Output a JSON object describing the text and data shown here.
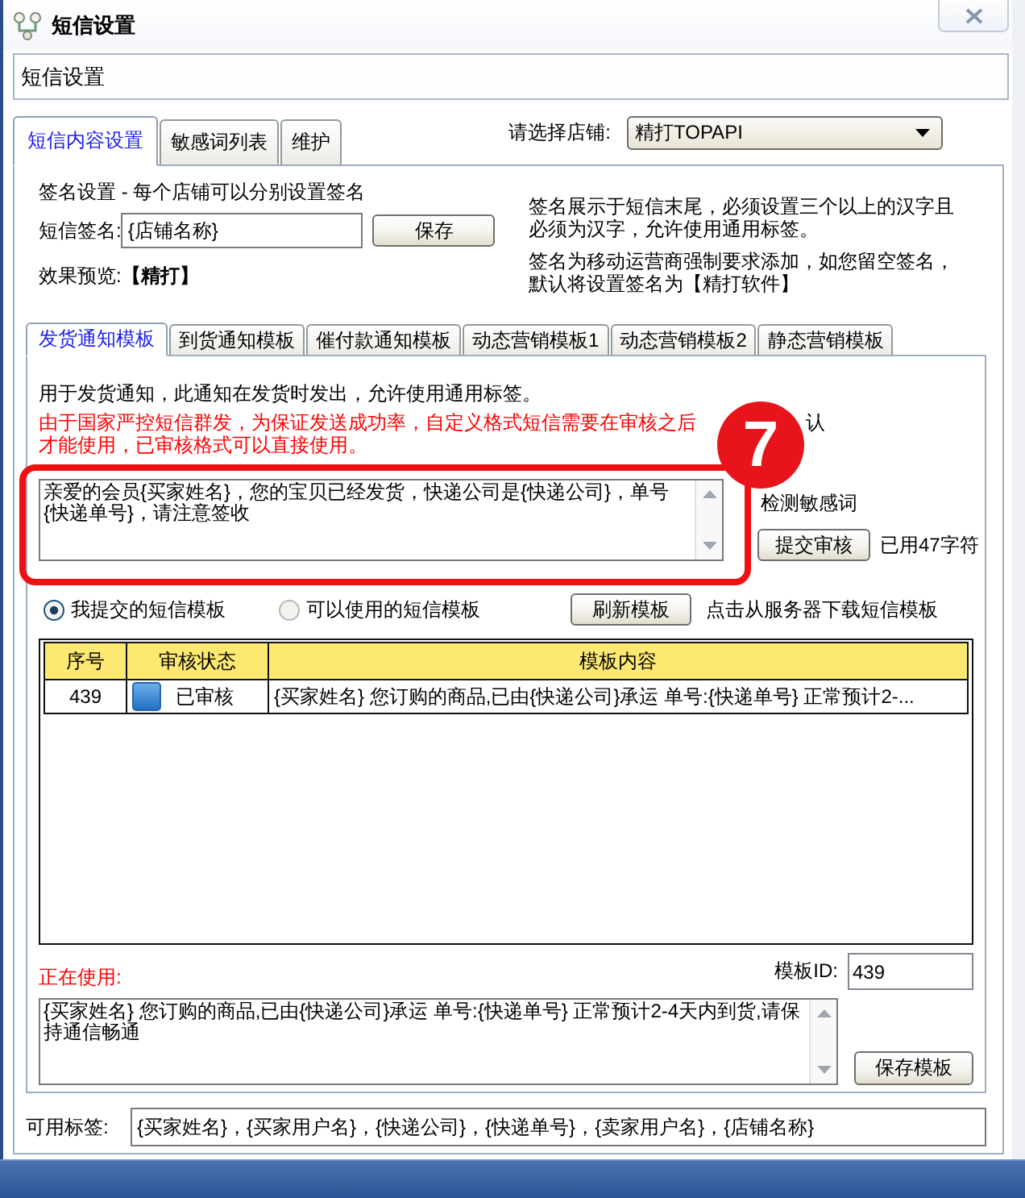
{
  "window": {
    "title": "短信设置"
  },
  "header": {
    "title": "短信设置"
  },
  "tabs": [
    {
      "label": "短信内容设置",
      "selected": true
    },
    {
      "label": "敏感词列表",
      "selected": false
    },
    {
      "label": "维护",
      "selected": false
    }
  ],
  "shop_select": {
    "label": "请选择店铺:",
    "value": "精打TOPAPI"
  },
  "signature": {
    "heading": "签名设置 - 每个店铺可以分别设置签名",
    "field_label": "短信签名:",
    "value": "{店铺名称}",
    "save_button": "保存",
    "preview_label": "效果预览:",
    "preview": "【精打】",
    "notes": [
      "签名展示于短信末尾，必须设置三个以上的汉字且必须为汉字，允许使用通用标签。",
      "签名为移动运营商强制要求添加，如您留空签名，默认将设置签名为【精打软件】"
    ]
  },
  "template_tabs": [
    {
      "label": "发货通知模板",
      "selected": true
    },
    {
      "label": "到货通知模板",
      "selected": false
    },
    {
      "label": "催付款通知模板",
      "selected": false
    },
    {
      "label": "动态营销模板1",
      "selected": false
    },
    {
      "label": "动态营销模板2",
      "selected": false
    },
    {
      "label": "静态营销模板",
      "selected": false
    }
  ],
  "template": {
    "description": "用于发货通知，此通知在发货时发出，允许使用通用标签。",
    "warning": "由于国家严控短信群发，为保证发送成功率，自定义格式短信需要在审核之后才能使用，已审核格式可以直接使用。",
    "content": "亲爱的会员{买家姓名}，您的宝贝已经发货，快递公司是{快递公司}，单号{快递单号}，请注意签收",
    "option_labels": [
      "认",
      "检测敏感词"
    ],
    "submit_button": "提交审核",
    "char_count": "已用47字符"
  },
  "callout": {
    "number": "7"
  },
  "list_filter": {
    "options": [
      {
        "label": "我提交的短信模板",
        "selected": true
      },
      {
        "label": "可以使用的短信模板",
        "selected": false
      }
    ],
    "refresh_button": "刷新模板",
    "hint": "点击从服务器下载短信模板"
  },
  "table": {
    "columns": [
      "序号",
      "审核状态",
      "模板内容"
    ],
    "rows": [
      {
        "id": "439",
        "status": "已审核",
        "content": "{买家姓名} 您订购的商品,已由{快递公司}承运 单号:{快递单号} 正常预计2-..."
      }
    ]
  },
  "in_use": {
    "label": "正在使用:",
    "id_label": "模板ID:",
    "id_value": "439",
    "content": "{买家姓名} 您订购的商品,已由{快递公司}承运 单号:{快递单号} 正常预计2-4天内到货,请保持通信畅通",
    "save_button": "保存模板"
  },
  "tags": {
    "label": "可用标签:",
    "value": "{买家姓名}，{买家用户名}，{快递公司}，{快递单号}，{卖家用户名}，{店铺名称}"
  }
}
